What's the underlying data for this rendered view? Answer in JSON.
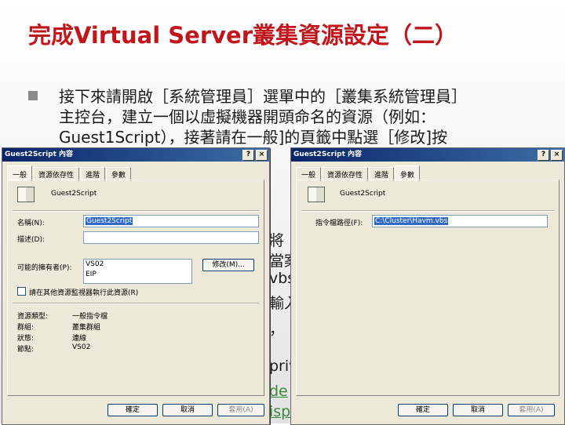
{
  "slide": {
    "title": "完成Virtual Server叢集資源設定（二）",
    "bullet_lines": [
      "接下來請開啟［系統管理員］選單中的［叢集系統管理員］",
      "主控台，建立一個以虛擬機器開頭命名的資源（例如：",
      "Guest1Script），接著請在一般]的頁籤中點選［修改]按"
    ],
    "partial_behind": [
      "將",
      "當案",
      "vbs",
      "輸入",
      "，",
      "priv",
      "de",
      "isp"
    ]
  },
  "dialogs": {
    "left": {
      "title": "Guest2Script 內容",
      "tabs": [
        "一般",
        "資源依存性",
        "進階",
        "參數"
      ],
      "resource_name": "Guest2Script",
      "name_label": "名稱(N):",
      "name_value": "Guest2Script",
      "desc_label": "描述(D):",
      "desc_value": "",
      "owners_label": "可能的擁有者(P):",
      "owners": [
        "VS02",
        "EIP"
      ],
      "modify_label": "修改(M)...",
      "checkbox_label": "請在其他資源監視器執行此資源(R)",
      "info": [
        {
          "label": "資源類型:",
          "value": "一般指令檔"
        },
        {
          "label": "群組:",
          "value": "叢集群組"
        },
        {
          "label": "狀態:",
          "value": "連線"
        },
        {
          "label": "節點:",
          "value": "VS02"
        }
      ],
      "ok": "確定",
      "cancel": "取消",
      "apply": "套用(A)"
    },
    "right": {
      "title": "Guest2Script 內容",
      "tabs": [
        "一般",
        "資源依存性",
        "進階",
        "參數"
      ],
      "resource_name": "Guest2Script",
      "script_label": "指令檔路徑(F):",
      "script_value": "C:\\Cluster\\Havm.vbs",
      "ok": "確定",
      "cancel": "取消",
      "apply": "套用(A)"
    }
  }
}
